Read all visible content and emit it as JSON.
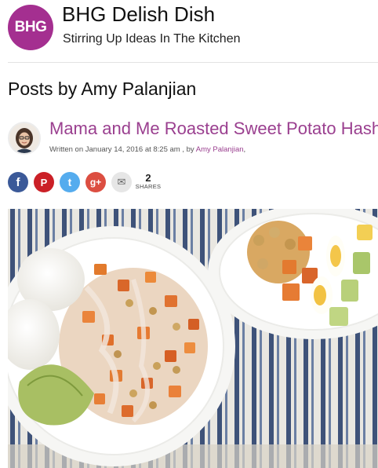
{
  "site": {
    "logo_text": "BHG",
    "title": "BHG Delish Dish",
    "tagline": "Stirring Up Ideas In The Kitchen"
  },
  "archive": {
    "heading": "Posts by Amy Palanjian"
  },
  "post": {
    "title": "Mama and Me Roasted Sweet Potato Hash with",
    "meta_prefix": "Written on January 14, 2016 at 8:25 am , by ",
    "author": "Amy Palanjian",
    "meta_suffix": ","
  },
  "share": {
    "buttons": [
      {
        "name": "facebook",
        "glyph": "f",
        "color": "#3b5998"
      },
      {
        "name": "pinterest",
        "glyph": "P",
        "color": "#cb2027"
      },
      {
        "name": "twitter",
        "glyph": "t",
        "color": "#55acee"
      },
      {
        "name": "google-plus",
        "glyph": "g+",
        "color": "#dc4e41"
      },
      {
        "name": "email",
        "glyph": "✉",
        "color": "#e6e6e6"
      }
    ],
    "count": "2",
    "count_label": "SHARES"
  },
  "colors": {
    "brand": "#a42f90",
    "link": "#9a3f8f"
  }
}
